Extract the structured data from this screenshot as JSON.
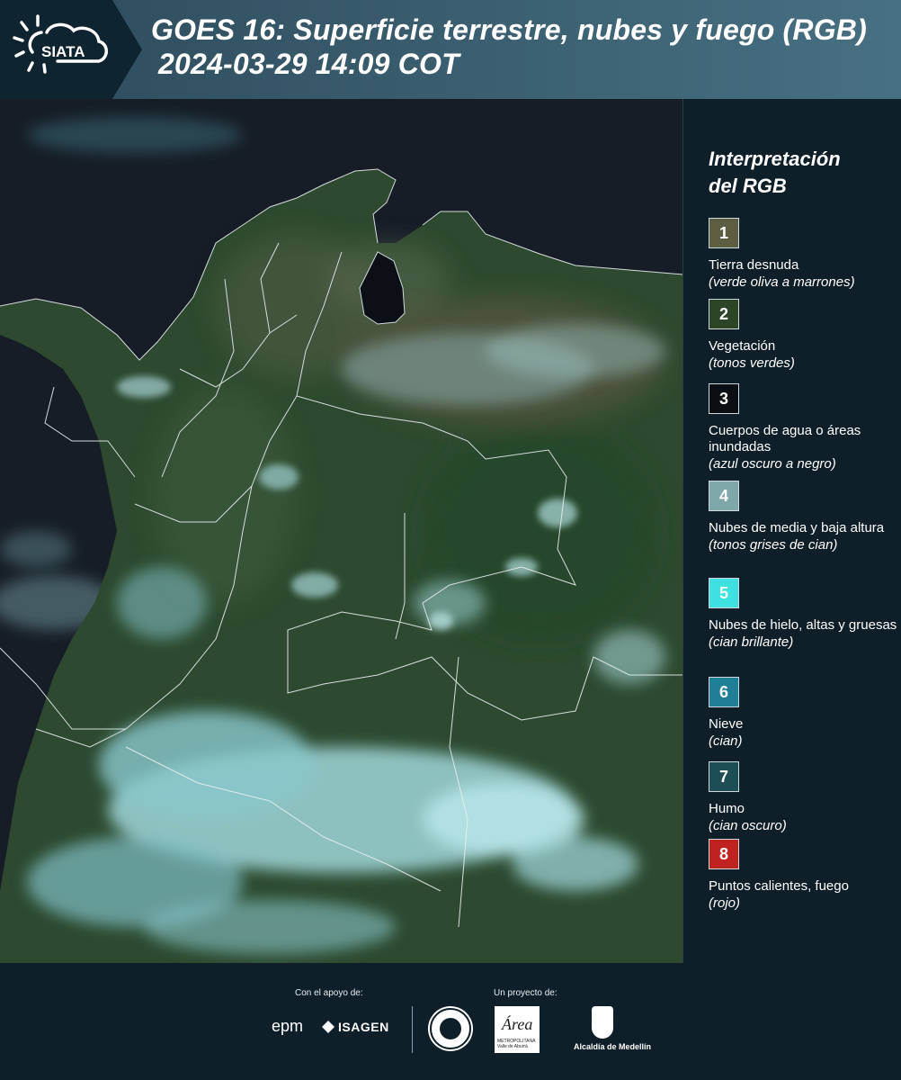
{
  "header": {
    "logo_text": "SIATA",
    "title_line1": "GOES 16: Superficie terrestre, nubes y fuego (RGB)",
    "title_line2": "2024-03-29 14:09 COT"
  },
  "legend": {
    "title_line1": "Interpretación",
    "title_line2": "del RGB",
    "items": [
      {
        "number": "1",
        "color": "#5d5d42",
        "name": "Tierra desnuda",
        "desc": "(verde oliva a marrones)"
      },
      {
        "number": "2",
        "color": "#2c4526",
        "name": "Vegetación",
        "desc": "(tonos verdes)"
      },
      {
        "number": "3",
        "color": "#0a0f14",
        "name": "Cuerpos de agua o áreas inundadas",
        "desc": "(azul oscuro a negro)"
      },
      {
        "number": "4",
        "color": "#7fa6a8",
        "name": "Nubes de media y baja altura",
        "desc": "(tonos grises de cian)"
      },
      {
        "number": "5",
        "color": "#3ee0e0",
        "name": "Nubes de hielo, altas y gruesas",
        "desc": "(cian brillante)"
      },
      {
        "number": "6",
        "color": "#1f7f96",
        "name": "Nieve",
        "desc": "(cian)"
      },
      {
        "number": "7",
        "color": "#1d4e56",
        "name": "Humo",
        "desc": "(cian oscuro)"
      },
      {
        "number": "8",
        "color": "#c0221f",
        "name": "Puntos calientes, fuego",
        "desc": "(rojo)"
      }
    ]
  },
  "footer": {
    "support_label": "Con el apoyo de:",
    "project_label": "Un proyecto de:",
    "epm": "epm",
    "isagen": "ISAGEN",
    "area_logo_text": "Área",
    "area_logo_sub": "METROPOLITANA Valle de Aburrá",
    "alcaldia": "Alcaldía de Medellín"
  }
}
